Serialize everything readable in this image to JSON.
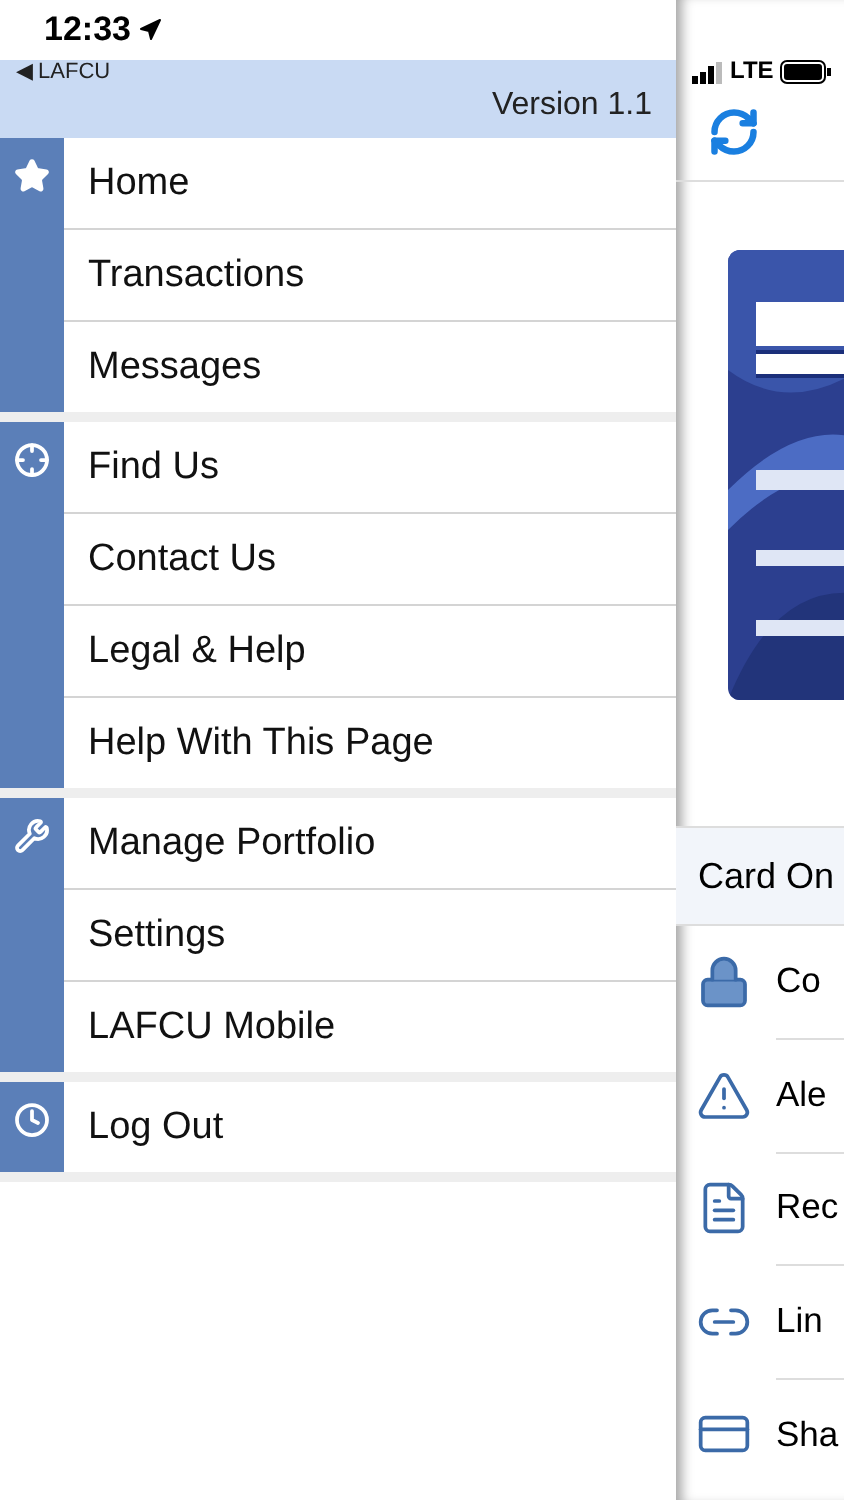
{
  "status_bar": {
    "time": "12:33",
    "network": "LTE"
  },
  "header": {
    "back_label": "◀ LAFCU",
    "version": "Version 1.1"
  },
  "menu_groups": [
    {
      "items": [
        {
          "label": "Home"
        },
        {
          "label": "Transactions"
        },
        {
          "label": "Messages"
        }
      ]
    },
    {
      "items": [
        {
          "label": "Find Us"
        },
        {
          "label": "Contact Us"
        },
        {
          "label": "Legal & Help"
        },
        {
          "label": "Help With This Page"
        }
      ]
    },
    {
      "items": [
        {
          "label": "Manage Portfolio"
        },
        {
          "label": "Settings"
        },
        {
          "label": "LAFCU Mobile"
        }
      ]
    },
    {
      "items": [
        {
          "label": "Log Out"
        }
      ]
    }
  ],
  "card_panel": {
    "section_title": "Card On",
    "rows": [
      {
        "label": "Co"
      },
      {
        "label": "Ale"
      },
      {
        "label": "Rec"
      },
      {
        "label": "Lin"
      },
      {
        "label": "Sha"
      }
    ]
  }
}
